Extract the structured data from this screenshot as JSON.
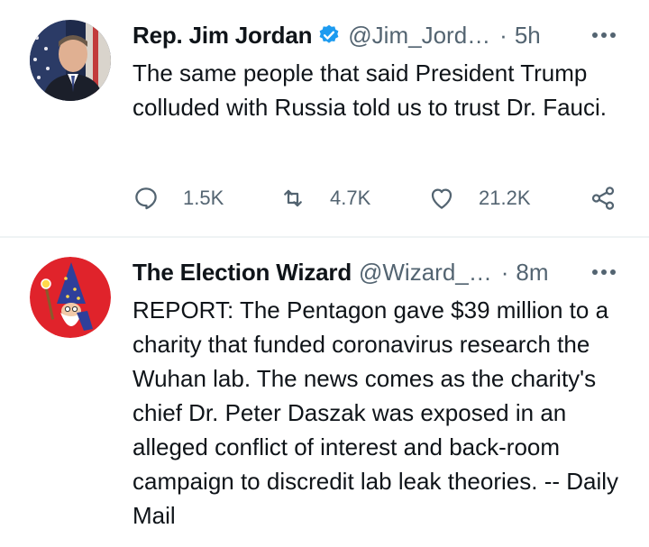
{
  "tweets": [
    {
      "name": "Rep. Jim Jordan",
      "handle": "@Jim_Jord…",
      "dot": "·",
      "time": "5h",
      "verified": true,
      "avatar_icon": "portrait-photo",
      "text": "The same people that said President Trump colluded with Russia told us to trust Dr. Fauci.",
      "stats": {
        "replies": "1.5K",
        "retweets": "4.7K",
        "likes": "21.2K"
      }
    },
    {
      "name": "The Election Wizard",
      "handle": "@Wizard_…",
      "dot": "·",
      "time": "8m",
      "verified": false,
      "avatar_icon": "wizard-gnome",
      "text": "REPORT: The Pentagon gave $39 million to a charity that funded coronavirus research the Wuhan lab. The news comes as the charity's chief Dr. Peter Daszak was exposed in an alleged conflict of interest and back-room campaign to discredit lab leak theories. -- Daily Mail"
    }
  ],
  "colors": {
    "text": "#0f1419",
    "muted": "#536471",
    "verified_blue": "#1d9bf0",
    "divider": "#eff3f4",
    "wizard_red": "#e0232b"
  }
}
